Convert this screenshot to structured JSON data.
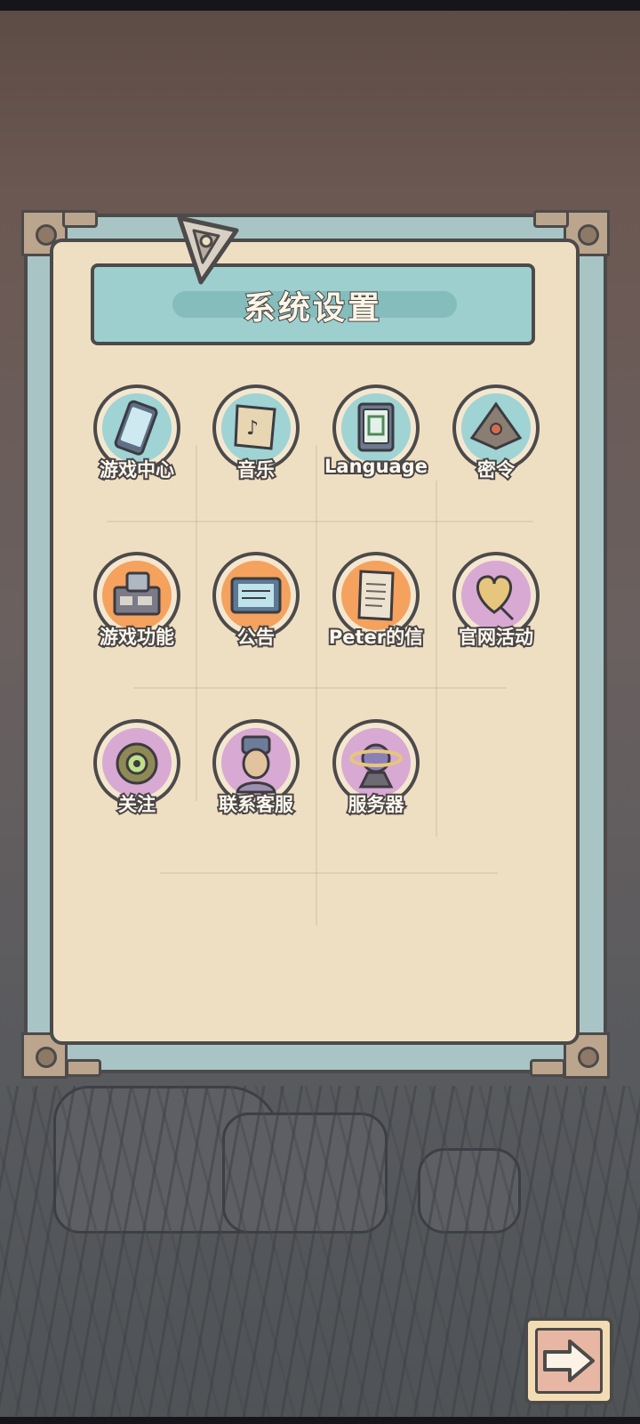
{
  "dialog": {
    "title": "系统设置"
  },
  "menu": {
    "items": [
      {
        "label": "游戏中心",
        "icon": "phone-icon",
        "bg": "#9fd3d4"
      },
      {
        "label": "音乐",
        "icon": "music-scroll-icon",
        "bg": "#9fd3d4"
      },
      {
        "label": "Language",
        "icon": "mahjong-tile-icon",
        "bg": "#9fd3d4"
      },
      {
        "label": "密令",
        "icon": "pyramid-eye-icon",
        "bg": "#9fd3d4"
      },
      {
        "label": "游戏功能",
        "icon": "machine-icon",
        "bg": "#f4a25e"
      },
      {
        "label": "公告",
        "icon": "notice-board-icon",
        "bg": "#f4a25e"
      },
      {
        "label": "Peter的信",
        "icon": "letter-icon",
        "bg": "#f4a25e"
      },
      {
        "label": "官网活动",
        "icon": "heart-balloon-icon",
        "bg": "#d8a9d2"
      },
      {
        "label": "关注",
        "icon": "amulet-icon",
        "bg": "#d8a9d2"
      },
      {
        "label": "联系客服",
        "icon": "pharaoh-icon",
        "bg": "#d8a9d2"
      },
      {
        "label": "服务器",
        "icon": "planet-icon",
        "bg": "#d8a9d2"
      }
    ]
  },
  "next_button": {
    "icon": "arrow-right-icon"
  }
}
